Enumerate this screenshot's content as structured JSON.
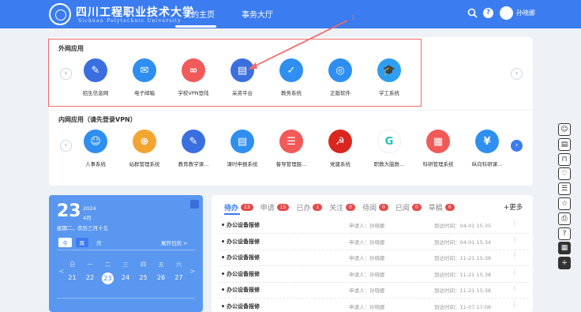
{
  "header": {
    "logo_cn": "四川工程职业技术大学",
    "logo_en": "Sichuan Polytechnic University",
    "nav": [
      "我的主页",
      "事务大厅"
    ],
    "user_name": "孙晓娜",
    "help": "?",
    "bg_color": "#3b7cf0"
  },
  "annotation": {
    "number": "1",
    "color": "#f06a6a"
  },
  "external_apps": {
    "title": "外网应用",
    "apps": [
      {
        "label": "招生信息网",
        "icon": "recruit-icon",
        "color": "#3b6fe0"
      },
      {
        "label": "电子邮箱",
        "icon": "email-icon",
        "color": "#2e8ff0"
      },
      {
        "label": "学校VPN登陆",
        "icon": "vpn-icon",
        "color": "#f25a5a"
      },
      {
        "label": "采资平台",
        "icon": "procurement-icon",
        "color": "#3b6fe0"
      },
      {
        "label": "教务系统",
        "icon": "academic-icon",
        "color": "#2e8ff0"
      },
      {
        "label": "正版软件",
        "icon": "software-icon",
        "color": "#2e8ff0"
      },
      {
        "label": "学工系统",
        "icon": "student-affairs-icon",
        "color": "#2e9ff0"
      }
    ]
  },
  "internal_apps": {
    "title": "内网应用（请先登录VPN）",
    "apps": [
      {
        "label": "人事系统",
        "icon": "hr-icon",
        "color": "#2e8ff0"
      },
      {
        "label": "站群管理系统",
        "icon": "site-group-icon",
        "color": "#f3a531"
      },
      {
        "label": "教育教学课...",
        "icon": "teaching-icon",
        "color": "#3b6fe0"
      },
      {
        "label": "课时申报系统",
        "icon": "class-hours-icon",
        "color": "#2e8ff0"
      },
      {
        "label": "督导管理服...",
        "icon": "supervision-icon",
        "color": "#f25a5a"
      },
      {
        "label": "党建系统",
        "icon": "party-icon",
        "color": "#d9271f"
      },
      {
        "label": "职教大脑数...",
        "icon": "brain-data-icon",
        "color": "#ffffff"
      },
      {
        "label": "科研管理系统",
        "icon": "research-icon",
        "color": "#f25a5a"
      },
      {
        "label": "纵向科研课...",
        "icon": "finance-icon",
        "color": "#2e8ff0"
      }
    ]
  },
  "calendar": {
    "day": "23",
    "year": "2024",
    "month": "4月",
    "date_line": "星期二，农历三月十五",
    "modes": [
      "今",
      "周",
      "月"
    ],
    "selected_mode": "周",
    "expand": "展开日历 >",
    "weekdays": [
      "日",
      "一",
      "二",
      "三",
      "四",
      "五",
      "六"
    ],
    "days": [
      "21",
      "22",
      "23",
      "24",
      "25",
      "26",
      "27"
    ],
    "today": "23",
    "prev": "<",
    "next": ">"
  },
  "tasks": {
    "tabs": [
      {
        "label": "待办",
        "count": "13"
      },
      {
        "label": "申请",
        "count": "15"
      },
      {
        "label": "已办",
        "count": "1"
      },
      {
        "label": "关注",
        "count": "0"
      },
      {
        "label": "待阅",
        "count": "0"
      },
      {
        "label": "已阅",
        "count": "0"
      },
      {
        "label": "草稿",
        "count": "0"
      }
    ],
    "more": "+更多",
    "rows": [
      {
        "title": "办公设备报修",
        "applicant": "申请人：孙晓娜",
        "time": "到达时间：04-01 15:35"
      },
      {
        "title": "办公设备报修",
        "applicant": "申请人：孙晓娜",
        "time": "到达时间：04-01 15:34"
      },
      {
        "title": "办公设备报修",
        "applicant": "申请人：孙晓娜",
        "time": "到达时间：11-21 15:38"
      },
      {
        "title": "办公设备报修",
        "applicant": "申请人：孙晓娜",
        "time": "到达时间：11-21 15:38"
      },
      {
        "title": "办公设备报修",
        "applicant": "申请人：孙晓娜",
        "time": "到达时间：11-21 15:38"
      },
      {
        "title": "办公设备报修",
        "applicant": "申请人：孙晓娜",
        "time": "到达时间：11-07 17:08"
      }
    ]
  },
  "right_rail": [
    "person-icon",
    "document-icon",
    "shirt-icon",
    "heart-icon",
    "list-icon",
    "star-icon",
    "printer-icon",
    "help-icon",
    "grid-icon",
    "plus-icon"
  ]
}
